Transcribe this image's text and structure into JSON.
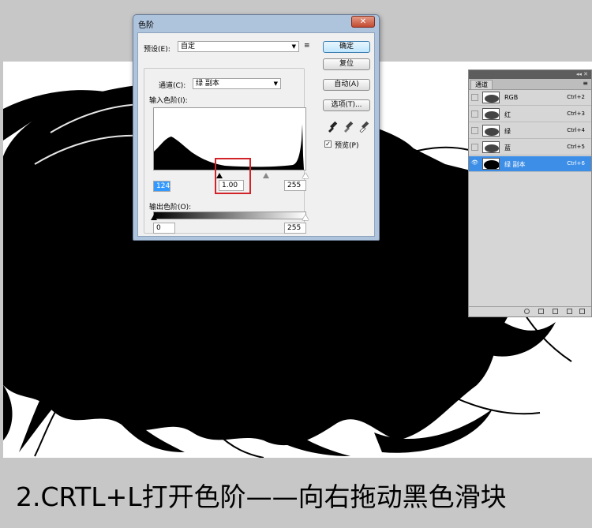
{
  "caption": "2.CRTL+L打开色阶——向右拖动黑色滑块",
  "dialog": {
    "title": "色阶",
    "close_icon": "✕",
    "preset_label": "预设(E):",
    "preset_value": "自定",
    "preset_menu_icon": "≡",
    "channel_label": "通道(C):",
    "channel_value": "绿 副本",
    "input_levels_label": "输入色阶(I):",
    "input_black": "124",
    "input_gamma": "1.00",
    "input_white": "255",
    "output_levels_label": "输出色阶(O):",
    "output_black": "0",
    "output_white": "255",
    "buttons": {
      "ok": "确定",
      "reset": "复位",
      "auto": "自动(A)",
      "options": "选项(T)..."
    },
    "preview_label": "预览(P)",
    "preview_checked": true,
    "eyedroppers": [
      "black-eyedropper-icon",
      "gray-eyedropper-icon",
      "white-eyedropper-icon"
    ]
  },
  "channels_panel": {
    "titlebar_controls": "◂◂ ✕",
    "tab": "通道",
    "menu_icon": "≡",
    "channels": [
      {
        "name": "RGB",
        "shortcut": "Ctrl+2",
        "visible": false,
        "selected": false
      },
      {
        "name": "红",
        "shortcut": "Ctrl+3",
        "visible": false,
        "selected": false
      },
      {
        "name": "绿",
        "shortcut": "Ctrl+4",
        "visible": false,
        "selected": false
      },
      {
        "name": "蓝",
        "shortcut": "Ctrl+5",
        "visible": false,
        "selected": false
      },
      {
        "name": "绿 副本",
        "shortcut": "Ctrl+6",
        "visible": true,
        "selected": true
      }
    ]
  },
  "colors": {
    "highlight": "#d2232a",
    "selected_row": "#3d8ee6",
    "dialog_frame": "#aec3dc"
  }
}
